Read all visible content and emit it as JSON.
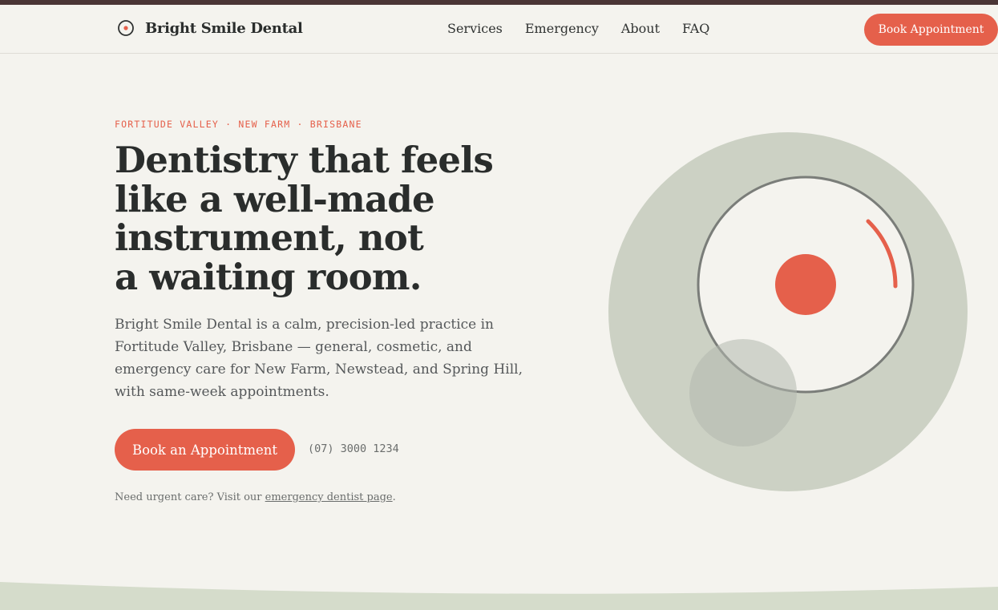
{
  "brand": {
    "name": "Bright Smile Dental",
    "icon": "target-dot-icon"
  },
  "nav": {
    "items": [
      {
        "label": "Services"
      },
      {
        "label": "Emergency"
      },
      {
        "label": "About"
      },
      {
        "label": "FAQ"
      }
    ],
    "cta_label": "Book Appointment"
  },
  "hero": {
    "eyebrow": "FORTITUDE VALLEY · NEW FARM · BRISBANE",
    "headline_lines": [
      "Dentistry that feels",
      "like a well-made",
      "instrument, not",
      "a waiting room."
    ],
    "lead_lines": [
      "Bright Smile Dental is a calm, precision-led practice in",
      "Fortitude Valley, Brisbane — general, cosmetic, and",
      "emergency care for New Farm, Newstead, and Spring Hill,",
      "with same-week appointments."
    ],
    "primary_cta": "Book an Appointment",
    "phone": "(07) 3000 1234",
    "urgent_prefix": "Need urgent care? Visit our ",
    "urgent_link": "emergency dentist page",
    "urgent_suffix": "."
  },
  "colors": {
    "accent": "#e5604b",
    "topbar": "#4a3535",
    "background": "#f4f3ee",
    "sage": "#ccd1c4",
    "wave": "#d5dccb"
  }
}
